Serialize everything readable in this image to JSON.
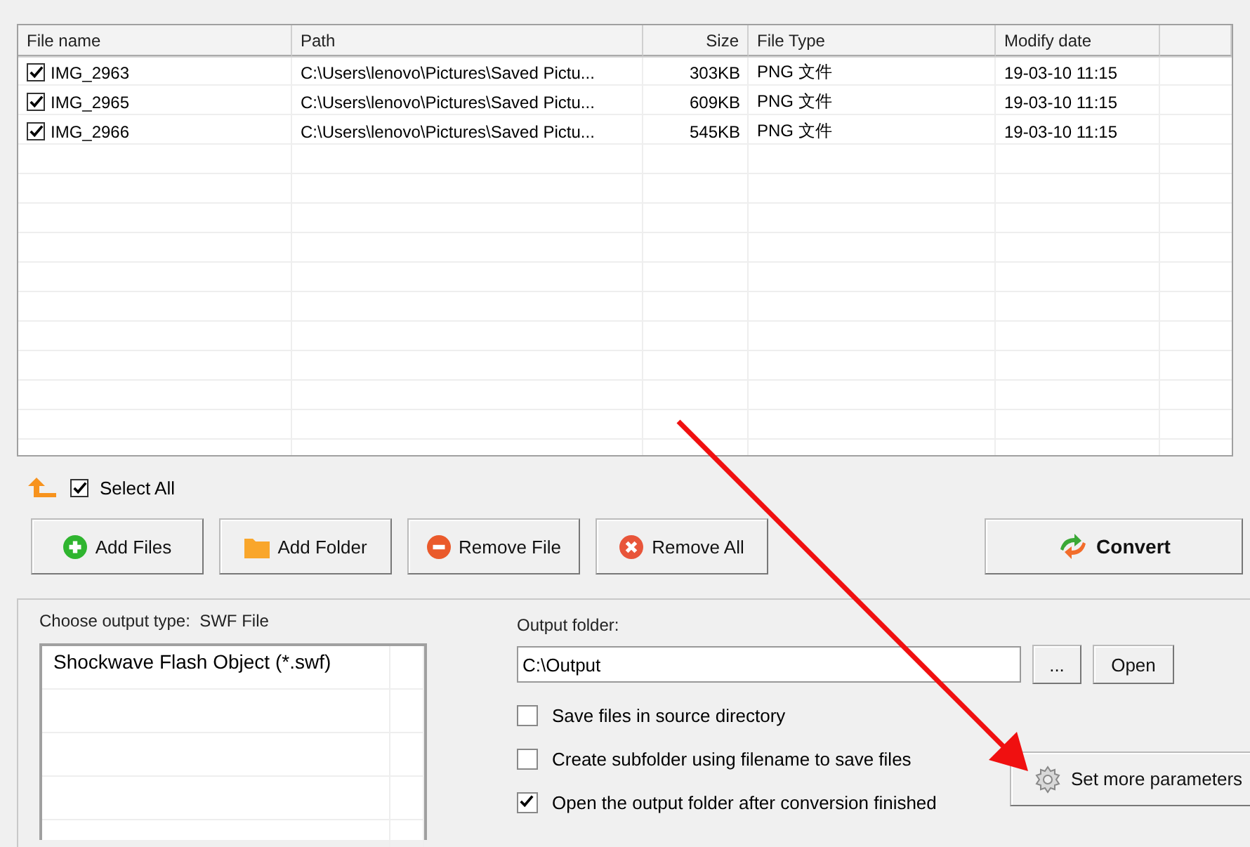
{
  "file_list": {
    "columns": [
      "File name",
      "Path",
      "Size",
      "File Type",
      "Modify date"
    ],
    "rows": [
      {
        "checked": true,
        "cells": [
          "IMG_2963",
          "C:\\Users\\lenovo\\Pictures\\Saved Pictu...",
          "303KB",
          "PNG 文件",
          "19-03-10 11:15"
        ]
      },
      {
        "checked": true,
        "cells": [
          "IMG_2965",
          "C:\\Users\\lenovo\\Pictures\\Saved Pictu...",
          "609KB",
          "PNG 文件",
          "19-03-10 11:15"
        ]
      },
      {
        "checked": true,
        "cells": [
          "IMG_2966",
          "C:\\Users\\lenovo\\Pictures\\Saved Pictu...",
          "545KB",
          "PNG 文件",
          "19-03-10 11:15"
        ]
      }
    ]
  },
  "select_all": {
    "label": "Select All",
    "checked": true
  },
  "buttons": [
    {
      "kind": "add",
      "label": "Add Files"
    },
    {
      "kind": "folder",
      "label": "Add Folder"
    },
    {
      "kind": "remove",
      "label": "Remove File"
    },
    {
      "kind": "clear",
      "label": "Remove All"
    }
  ],
  "convert_button": {
    "label": "Convert"
  },
  "output_type": {
    "label": "Choose output type:",
    "value": "SWF File",
    "options": [
      "Shockwave Flash Object (*.swf)"
    ]
  },
  "output_folder": {
    "label": "Output folder:",
    "value": "C:\\Output",
    "browse": "...",
    "open": "Open"
  },
  "options": [
    {
      "label": "Save files in source directory",
      "checked": false
    },
    {
      "label": "Create subfolder using filename to save files",
      "checked": false
    },
    {
      "label": "Open the output folder after conversion finished",
      "checked": true
    }
  ],
  "more_button": {
    "label": "Set more parameters"
  }
}
